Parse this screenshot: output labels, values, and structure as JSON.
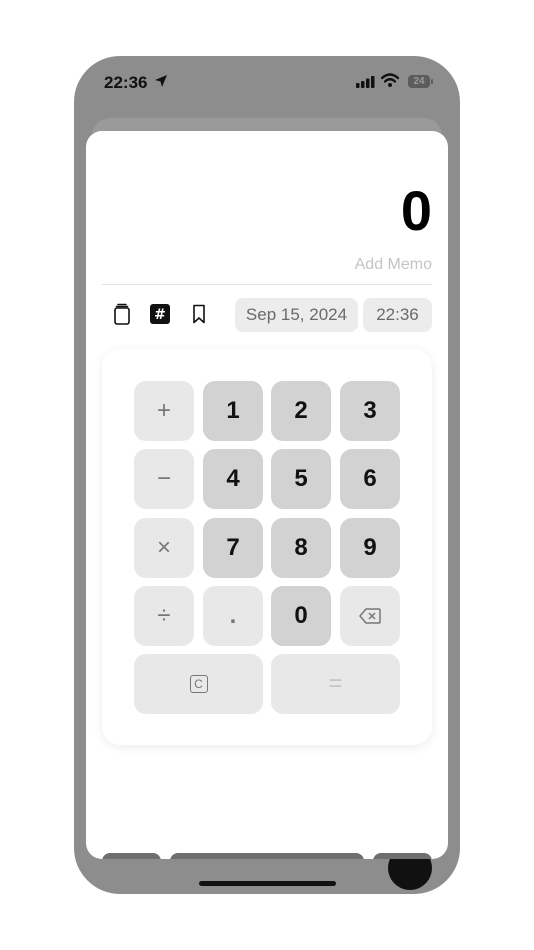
{
  "status_bar": {
    "time": "22:36",
    "battery": "24"
  },
  "entry": {
    "amount": "0",
    "memo_placeholder": "Add Memo"
  },
  "meta": {
    "date": "Sep 15, 2024",
    "time": "22:36"
  },
  "toolbar": {
    "icons": [
      "clipboard-icon",
      "hash-icon",
      "bookmark-icon"
    ]
  },
  "keypad": {
    "op_plus": "+",
    "op_minus": "−",
    "op_times": "×",
    "op_divide": "÷",
    "k1": "1",
    "k2": "2",
    "k3": "3",
    "k4": "4",
    "k5": "5",
    "k6": "6",
    "k7": "7",
    "k8": "8",
    "k9": "9",
    "dot": ".",
    "k0": "0",
    "clear": "C",
    "equals": "="
  },
  "colors": {
    "accent_dark": "#6f6f6f",
    "key_dark": "#d2d2d2",
    "key_light": "#e8e8e8",
    "backdrop": "#8d8d8d"
  }
}
